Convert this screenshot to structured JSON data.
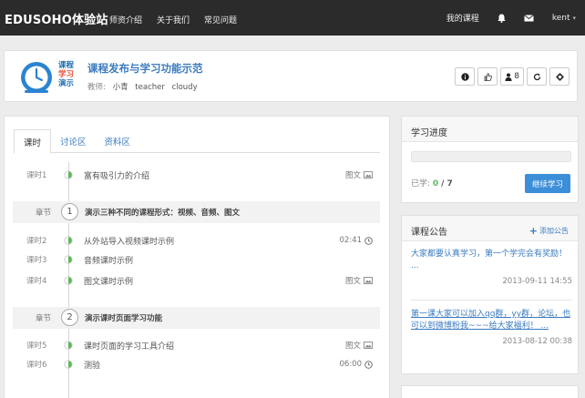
{
  "navbar": {
    "brand": "EDUSOHO体验站",
    "links": [
      "师资介绍",
      "关于我们",
      "常见问题"
    ],
    "my_courses": "我的课程",
    "user": "kent"
  },
  "course": {
    "logo_lines": [
      "课程",
      "学习",
      "演示"
    ],
    "title": "课程发布与学习功能示范",
    "teacher_label": "教师:",
    "teachers": [
      "小青",
      "teacher",
      "cloudy"
    ],
    "student_count": "8"
  },
  "tabs": [
    "课时",
    "讨论区",
    "资料区"
  ],
  "lessons": [
    {
      "kind": "lesson",
      "num": "课时1",
      "title": "富有吸引力的介绍",
      "meta": "图文",
      "icon": "image-icon"
    },
    {
      "kind": "chapter",
      "num": "章节",
      "badge": "1",
      "title": "演示三种不同的课程形式：视频、音频、图文"
    },
    {
      "kind": "lesson",
      "num": "课时2",
      "title": "从外站导入视频课时示例",
      "meta": "02:41",
      "icon": "clock-icon"
    },
    {
      "kind": "lesson",
      "num": "课时3",
      "title": "音频课时示例",
      "meta": "",
      "icon": ""
    },
    {
      "kind": "lesson",
      "num": "课时4",
      "title": "图文课时示例",
      "meta": "图文",
      "icon": "image-icon"
    },
    {
      "kind": "chapter",
      "num": "章节",
      "badge": "2",
      "title": "演示课时页面学习功能"
    },
    {
      "kind": "lesson",
      "num": "课时5",
      "title": "课时页面的学习工具介绍",
      "meta": "图文",
      "icon": "image-icon"
    },
    {
      "kind": "lesson",
      "num": "课时6",
      "title": "测验",
      "meta": "06:00",
      "icon": "clock-icon"
    }
  ],
  "progress": {
    "heading": "学习进度",
    "learned_label": "已学:",
    "learned": "0",
    "total": "/ 7",
    "fraction": 0,
    "continue_label": "继续学习"
  },
  "notices": {
    "heading": "课程公告",
    "add_label": "添加公告",
    "items": [
      {
        "text": "大家都要认真学习，第一个学完会有奖励！ ...",
        "date": "2013-09-11 14:55"
      },
      {
        "text": "第一课大家可以加入qq群，yy群，论坛，也可以到微博粉我~~~给大家福利！ ...",
        "date": "2013-08-12 00:38"
      }
    ]
  },
  "colors": {
    "accent": "#3b7bbf",
    "nav_bg": "#2b2b2b",
    "button": "#3b8ed8",
    "progress": "#5cb85c"
  }
}
